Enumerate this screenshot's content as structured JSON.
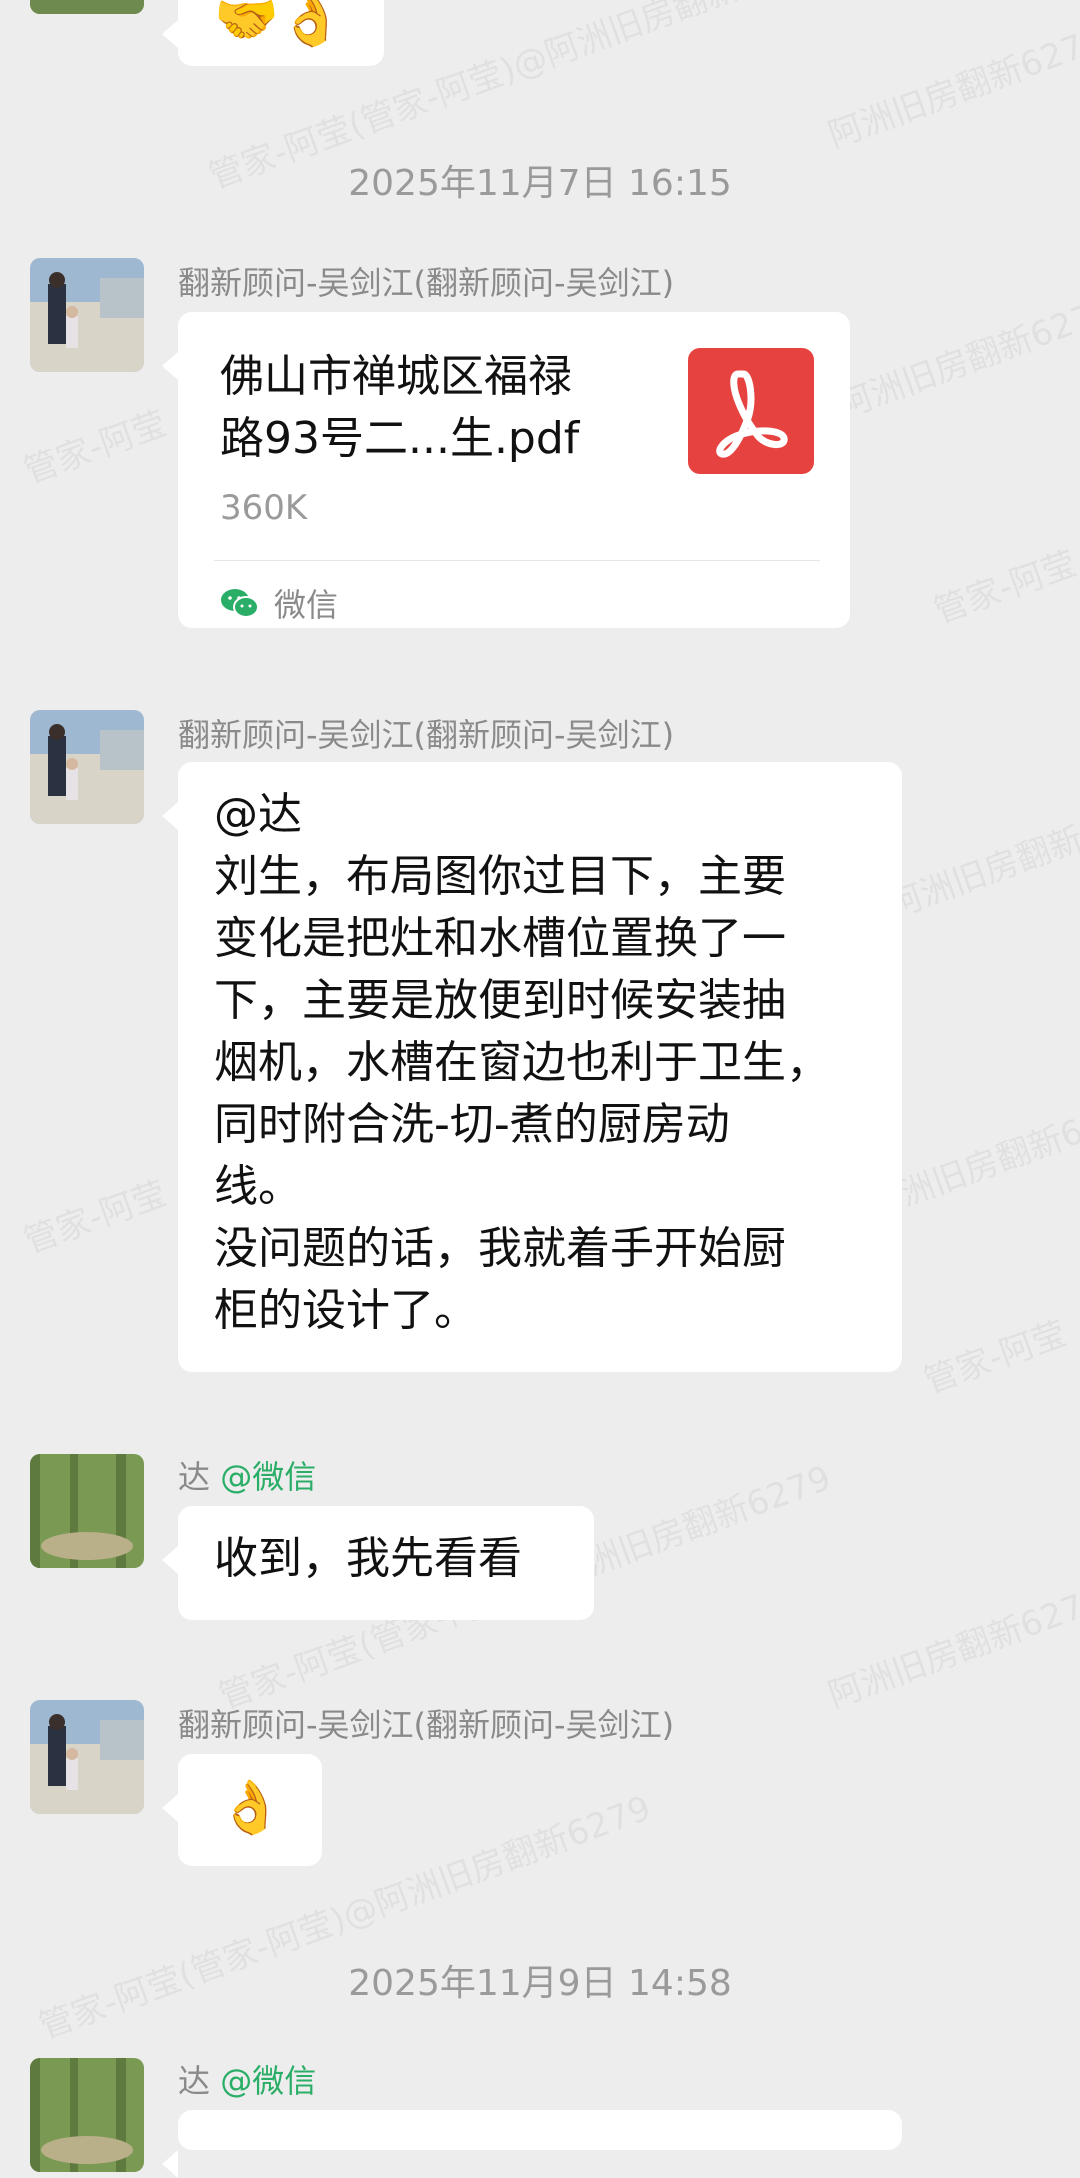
{
  "watermark": {
    "text_main": "管家-阿莹(管家-阿莹)@阿洲旧房翻新6279",
    "text_short": "管家-阿莹",
    "text_right": "阿洲旧房翻新6279"
  },
  "messages": [
    {
      "type": "emoji",
      "sender_side": "top_partial",
      "content": "🤝👌"
    },
    {
      "type": "timestamp",
      "text": "2025年11月7日  16:15"
    },
    {
      "type": "file",
      "sender": "翻新顾问-吴剑江(翻新顾问-吴剑江)",
      "file_name_lines": [
        "佛山市禅城区福禄",
        "路93号二...生.pdf"
      ],
      "file_size": "360K",
      "source": "微信",
      "icon": "pdf-icon",
      "icon_color": "#e64340"
    },
    {
      "type": "text",
      "sender": "翻新顾问-吴剑江(翻新顾问-吴剑江)",
      "lines": [
        "@达",
        "刘生，布局图你过目下，主要",
        "变化是把灶和水槽位置换了一",
        "下，主要是放便到时候安装抽",
        "烟机，水槽在窗边也利于卫生，",
        "同时附合洗-切-煮的厨房动",
        "线。",
        "没问题的话，我就着手开始厨",
        "柜的设计了。"
      ]
    },
    {
      "type": "text",
      "sender": "达",
      "sender_tag": "@微信",
      "lines": [
        "收到，我先看看"
      ]
    },
    {
      "type": "emoji",
      "sender": "翻新顾问-吴剑江(翻新顾问-吴剑江)",
      "content": "👌"
    },
    {
      "type": "timestamp",
      "text": "2025年11月9日  14:58"
    },
    {
      "type": "partial",
      "sender": "达",
      "sender_tag": "@微信"
    }
  ],
  "colors": {
    "background": "#ededed",
    "bubble": "#ffffff",
    "sender_name": "#8a8a8a",
    "wechat_tag": "#2aae67",
    "timestamp": "#9a9a9a",
    "pdf_red": "#e64340"
  }
}
